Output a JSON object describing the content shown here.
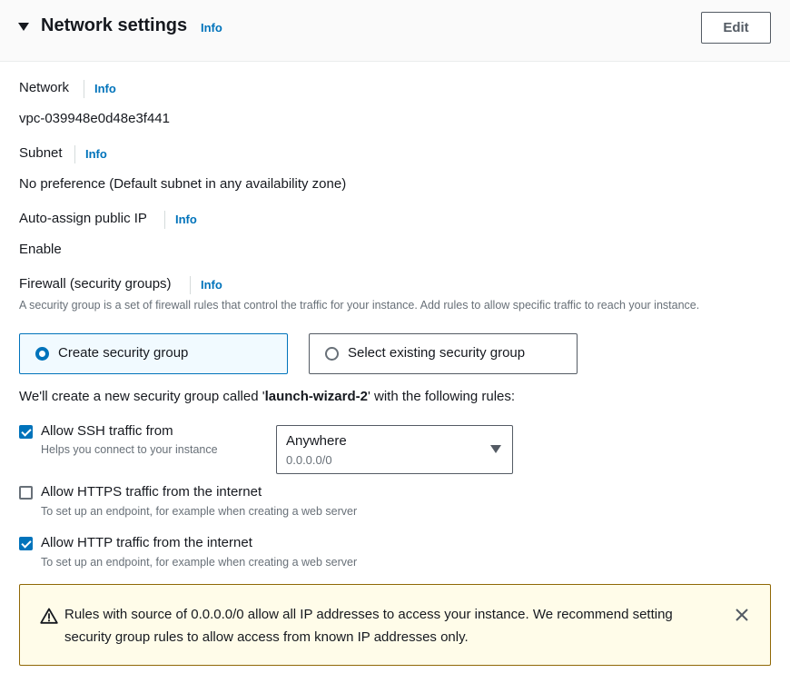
{
  "header": {
    "title": "Network settings",
    "info": "Info",
    "edit_label": "Edit"
  },
  "network": {
    "label": "Network",
    "info": "Info",
    "value": "vpc-039948e0d48e3f441"
  },
  "subnet": {
    "label": "Subnet",
    "info": "Info",
    "value": "No preference (Default subnet in any availability zone)"
  },
  "public_ip": {
    "label": "Auto-assign public IP",
    "info": "Info",
    "value": "Enable"
  },
  "firewall": {
    "label": "Firewall (security groups)",
    "info": "Info",
    "description": "A security group is a set of firewall rules that control the traffic for your instance. Add rules to allow specific traffic to reach your instance.",
    "options": [
      {
        "label": "Create security group",
        "selected": true
      },
      {
        "label": "Select existing security group",
        "selected": false
      }
    ],
    "statement_prefix": "We'll create a new security group called '",
    "statement_name": "launch-wizard-2",
    "statement_suffix": "' with the following rules:"
  },
  "rules": [
    {
      "label": "Allow SSH traffic from",
      "description": "Helps you connect to your instance",
      "checked": true
    },
    {
      "label": "Allow HTTPS traffic from the internet",
      "description": "To set up an endpoint, for example when creating a web server",
      "checked": false
    },
    {
      "label": "Allow HTTP traffic from the internet",
      "description": "To set up an endpoint, for example when creating a web server",
      "checked": true
    }
  ],
  "ssh_source": {
    "value": "Anywhere",
    "sub": "0.0.0.0/0"
  },
  "alert": {
    "text": "Rules with source of 0.0.0.0/0 allow all IP addresses to access your instance. We recommend setting security group rules to allow access from known IP addresses only.",
    "icon": "warning-icon"
  },
  "colors": {
    "accent": "#0073bb",
    "warning_border": "#906806",
    "warning_bg": "#fffce9"
  }
}
